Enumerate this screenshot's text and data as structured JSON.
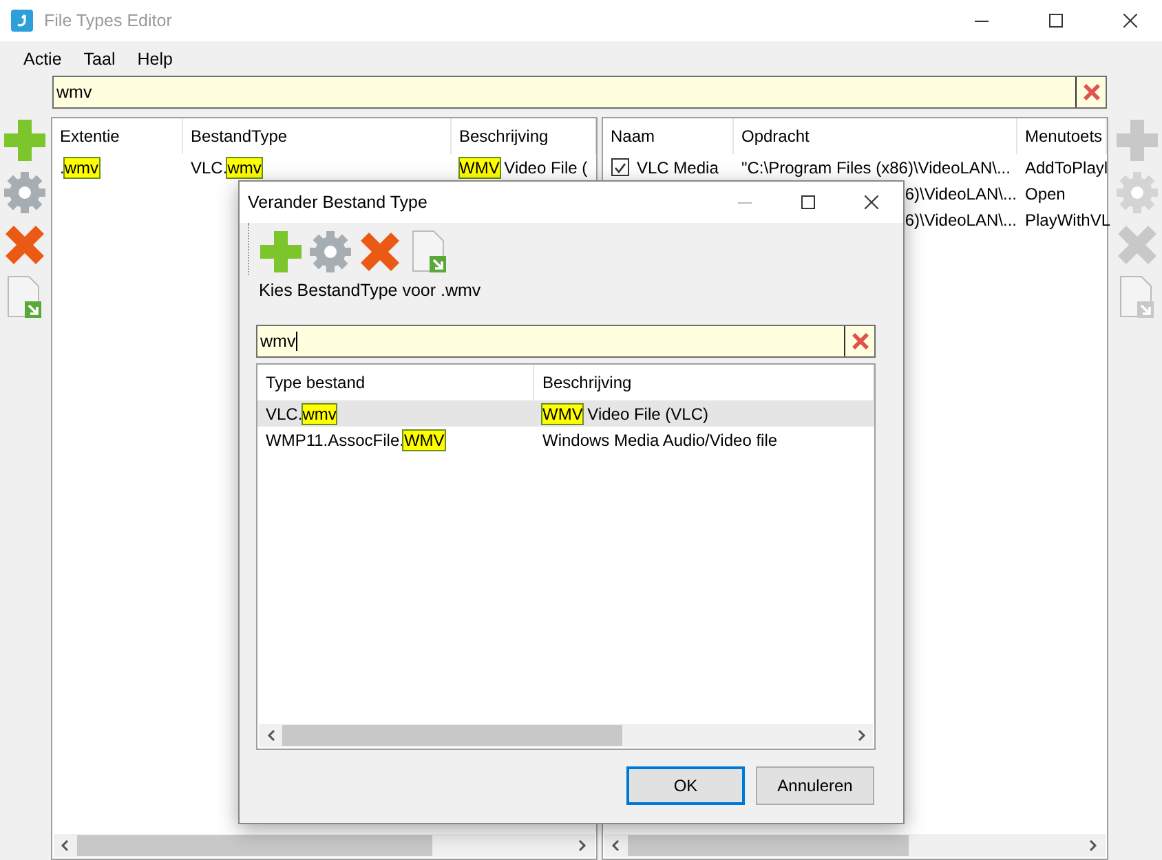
{
  "window": {
    "title": "File Types Editor"
  },
  "menu": [
    "Actie",
    "Taal",
    "Help"
  ],
  "search": {
    "value": "wmv"
  },
  "left_toolbar": {
    "disabled": false
  },
  "right_toolbar": {
    "disabled": true
  },
  "extensions": {
    "columns": [
      "Extentie",
      "BestandType",
      "Beschrijving"
    ],
    "rows": [
      {
        "cells": [
          [
            {
              "text": ".",
              "highlighted": false
            },
            {
              "text": "wmv",
              "highlighted": true
            }
          ],
          [
            {
              "text": "VLC.",
              "highlighted": false
            },
            {
              "text": "wmv",
              "highlighted": true
            }
          ],
          [
            {
              "text": "WMV",
              "highlighted": true
            },
            {
              "text": " Video File (",
              "highlighted": false
            }
          ]
        ]
      }
    ]
  },
  "commands": {
    "columns": [
      "Naam",
      "Opdracht",
      "Menutoets"
    ],
    "rows": [
      {
        "checked": true,
        "name": "VLC Media",
        "command": "\"C:\\Program Files (x86)\\VideoLAN\\...",
        "key": "AddToPlayl"
      },
      {
        "command": "6)\\VideoLAN\\...",
        "key": "Open"
      },
      {
        "command": "6)\\VideoLAN\\...",
        "key": "PlayWithVL"
      }
    ]
  },
  "dialog": {
    "title": "Verander Bestand Type",
    "toolbar_disabled": false,
    "prompt": "Kies BestandType voor .wmv",
    "search": {
      "value": "wmv"
    },
    "columns": [
      "Type bestand",
      "Beschrijving"
    ],
    "rows": [
      {
        "selected": true,
        "cells": [
          [
            {
              "text": "VLC.",
              "highlighted": false
            },
            {
              "text": "wmv",
              "highlighted": true
            }
          ],
          [
            {
              "text": "WMV",
              "highlighted": true
            },
            {
              "text": " Video File (VLC)",
              "highlighted": false
            }
          ]
        ]
      },
      {
        "selected": false,
        "cells": [
          [
            {
              "text": "WMP11.AssocFile.",
              "highlighted": false
            },
            {
              "text": "WMV",
              "highlighted": true
            }
          ],
          [
            {
              "text": "Windows Media Audio/Video file",
              "highlighted": false
            }
          ]
        ]
      }
    ],
    "buttons": [
      {
        "label": "OK",
        "default": true
      },
      {
        "label": "Annuleren",
        "default": false
      }
    ]
  }
}
